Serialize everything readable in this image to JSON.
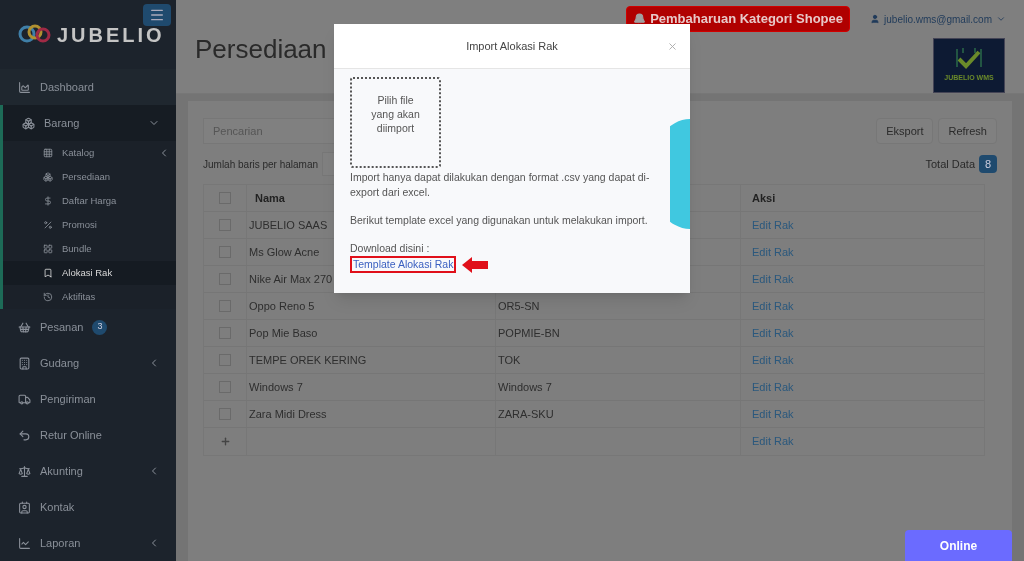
{
  "sidebar": {
    "logo": "JUBELIO",
    "items": [
      {
        "label": "Dashboard",
        "selected": false
      },
      {
        "label": "Barang",
        "selected": false,
        "expanded": true,
        "children": [
          {
            "label": "Katalog",
            "selected": false,
            "expanded": false
          },
          {
            "label": "Persediaan",
            "selected": false
          },
          {
            "label": "Daftar Harga",
            "selected": false
          },
          {
            "label": "Promosi",
            "selected": false
          },
          {
            "label": "Bundle",
            "selected": false
          },
          {
            "label": "Alokasi Rak",
            "selected": true
          },
          {
            "label": "Aktifitas",
            "selected": false
          }
        ]
      },
      {
        "label": "Pesanan",
        "selected": false,
        "badge": "3"
      },
      {
        "label": "Gudang",
        "selected": false,
        "expanded": false
      },
      {
        "label": "Pengiriman",
        "selected": false
      },
      {
        "label": "Retur Online",
        "selected": false
      },
      {
        "label": "Akunting",
        "selected": false,
        "expanded": false
      },
      {
        "label": "Kontak",
        "selected": false
      },
      {
        "label": "Laporan",
        "selected": false,
        "expanded": false
      }
    ]
  },
  "header": {
    "title": "Persediaan",
    "notice": "Pembaharuan Kategori Shopee",
    "user": "jubelio.wms@gmail.com",
    "brand_logo": "JUBELIO WMS"
  },
  "toolbar": {
    "search": {
      "placeholder": "Pencarian"
    },
    "buttons": [
      "Eksport",
      "Refresh"
    ],
    "rows_per_page_label": "Jumlah baris per halaman",
    "total_label": "Total Data",
    "total": "8"
  },
  "table": {
    "columns": [
      "Nama",
      "Aksi"
    ],
    "select_all_checked": false,
    "rows": [
      {
        "checked": false,
        "name": "JUBELIO SAAS",
        "action": "Edit Rak"
      },
      {
        "checked": false,
        "name": "Ms Glow Acne",
        "action": "Edit Rak"
      },
      {
        "checked": false,
        "name": "Nike Air Max 270",
        "action": "Edit Rak"
      },
      {
        "checked": false,
        "name": "Oppo Reno 5",
        "sku": "OR5-SN",
        "action": "Edit Rak"
      },
      {
        "checked": false,
        "name": "Pop Mie Baso",
        "sku": "POPMIE-BN",
        "action": "Edit Rak"
      },
      {
        "checked": false,
        "name": "TEMPE OREK KERING",
        "sku": "TOK",
        "action": "Edit Rak"
      },
      {
        "checked": false,
        "name": "Windows 7",
        "sku": "Windows 7",
        "action": "Edit Rak"
      },
      {
        "checked": false,
        "name": "Zara Midi Dress",
        "sku": "ZARA-SKU",
        "action": "Edit Rak"
      }
    ],
    "add_row": {
      "action": "Edit Rak"
    }
  },
  "modal": {
    "title": "Import Alokasi Rak",
    "dropzone": "Pilih file yang akan diimport",
    "note": "Import hanya dapat dilakukan dengan format .csv yang dapat di-export dari excel.",
    "template_note": "Berikut template excel yang digunakan untuk melakukan import.",
    "download_label": "Download disini :",
    "download_link": "Template Alokasi Rak"
  },
  "chat_button": "Online"
}
